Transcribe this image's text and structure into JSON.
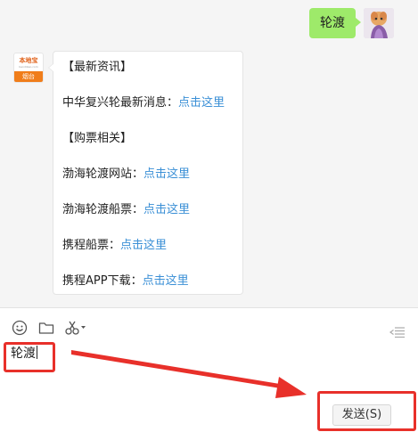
{
  "chat": {
    "outgoing_message": "轮渡",
    "shop_avatar": {
      "brand": "本地宝",
      "domain": "bendibao.com",
      "city": "烟台"
    },
    "reply_lines": [
      {
        "text": "【最新资讯】",
        "link": ""
      },
      {
        "text": "中华复兴轮最新消息：",
        "link": "点击这里"
      },
      {
        "text": "【购票相关】",
        "link": ""
      },
      {
        "text": "渤海轮渡网站：",
        "link": "点击这里"
      },
      {
        "text": "渤海轮渡船票：",
        "link": "点击这里"
      },
      {
        "text": "携程船票：",
        "link": "点击这里"
      },
      {
        "text": "携程APP下载：",
        "link": "点击这里"
      }
    ]
  },
  "toolbar": {
    "icons": [
      "emoji-icon",
      "folder-icon",
      "scissors-icon",
      "collapse-icon"
    ]
  },
  "composer": {
    "input_value": "轮渡",
    "send_label": "发送(S)"
  },
  "colors": {
    "bubble_out": "#9eea6a",
    "link": "#3a8fd6",
    "annotation": "#e8302a",
    "brand_orange": "#f07d1a"
  }
}
